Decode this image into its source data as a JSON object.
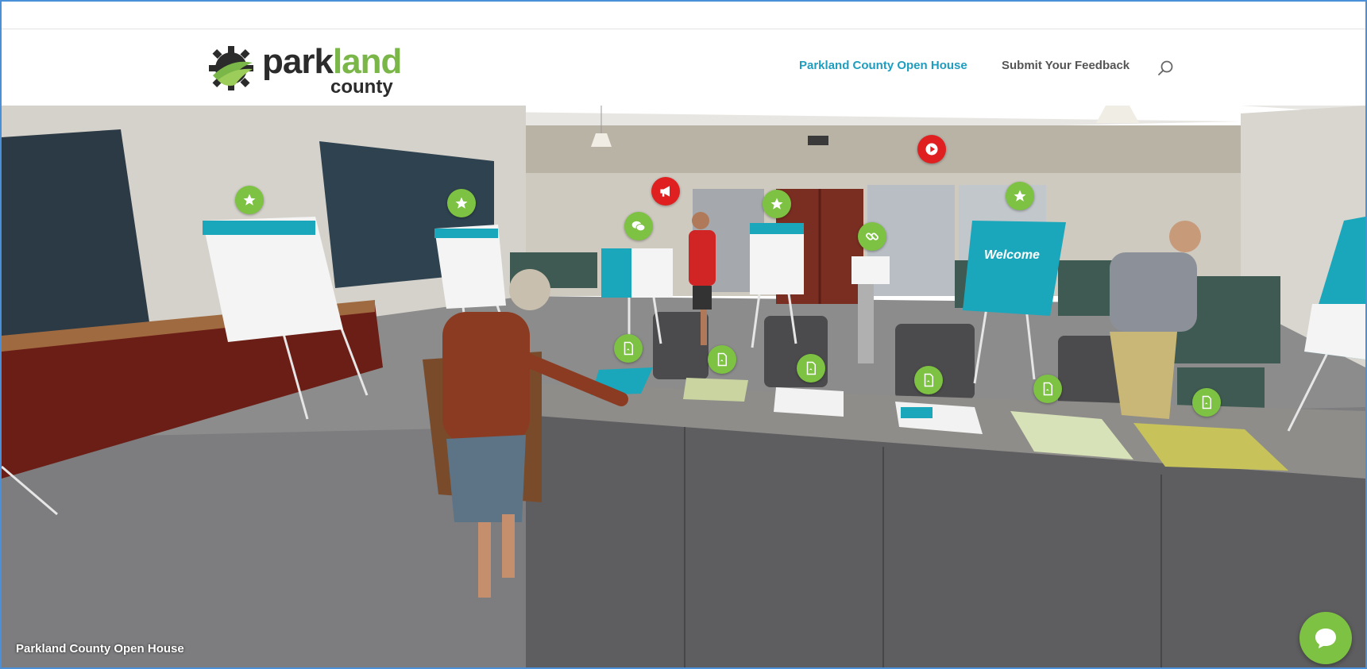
{
  "header": {
    "logo_word_park": "park",
    "logo_word_land": "land",
    "logo_word_county": "county",
    "nav": [
      {
        "label": "Parkland County Open House",
        "active": true
      },
      {
        "label": "Submit Your Feedback",
        "active": false
      }
    ],
    "search_icon": "search-icon"
  },
  "scene": {
    "caption": "Parkland County Open House",
    "welcome_board_title": "Welcome",
    "hotspots": [
      {
        "icon": "star-icon",
        "color": "green"
      },
      {
        "icon": "star-icon",
        "color": "green"
      },
      {
        "icon": "megaphone-icon",
        "color": "red"
      },
      {
        "icon": "chat-bubbles-icon",
        "color": "green"
      },
      {
        "icon": "star-icon",
        "color": "green"
      },
      {
        "icon": "play-icon",
        "color": "red"
      },
      {
        "icon": "link-icon",
        "color": "green"
      },
      {
        "icon": "star-icon",
        "color": "green"
      },
      {
        "icon": "pdf-icon",
        "color": "green"
      },
      {
        "icon": "pdf-icon",
        "color": "green"
      },
      {
        "icon": "pdf-icon",
        "color": "green"
      },
      {
        "icon": "pdf-icon",
        "color": "green"
      },
      {
        "icon": "pdf-icon",
        "color": "green"
      },
      {
        "icon": "pdf-icon",
        "color": "green"
      }
    ]
  },
  "chat_widget": {
    "icon": "chat-icon"
  },
  "colors": {
    "brand_green": "#7dc242",
    "brand_teal": "#1e9dbf",
    "hotspot_red": "#e02020",
    "frame_blue": "#4a90d9"
  }
}
